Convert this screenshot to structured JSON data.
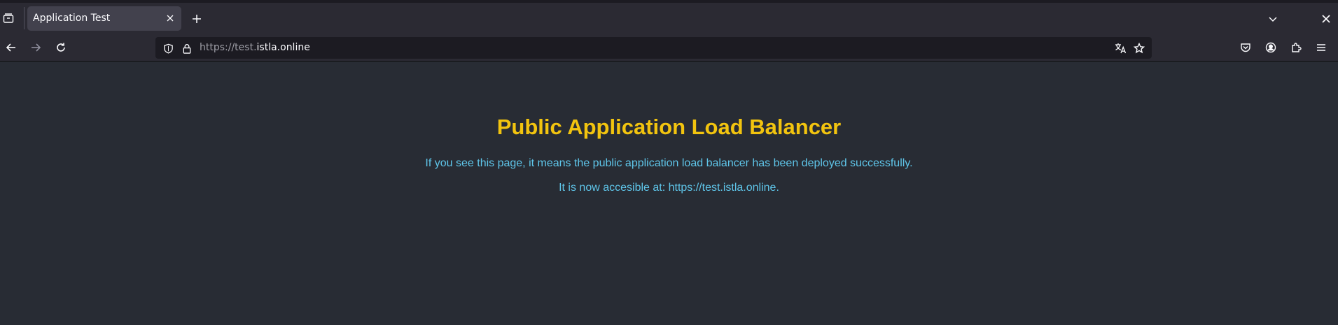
{
  "browser": {
    "tab": {
      "title": "Application Test",
      "icons": [
        "tab-manager-icon",
        "close-icon",
        "plus-icon",
        "chevron-down-icon"
      ]
    },
    "toolbar": {
      "icons": [
        "back-arrow-icon",
        "forward-arrow-icon",
        "reload-icon",
        "shield-icon",
        "lock-icon",
        "translate-icon",
        "star-icon",
        "pocket-icon",
        "account-icon",
        "extensions-icon",
        "menu-icon"
      ]
    },
    "url": {
      "scheme": "https://test.",
      "host": "istla.online"
    }
  },
  "page": {
    "heading": "Public Application Load Balancer",
    "line1": "If you see this page, it means the public application load balancer has been deployed successfully.",
    "line2": "It is now accesible at: https://test.istla.online.",
    "colors": {
      "background": "#282c34",
      "heading": "#f2c40f",
      "text": "#5fc6ea"
    }
  }
}
